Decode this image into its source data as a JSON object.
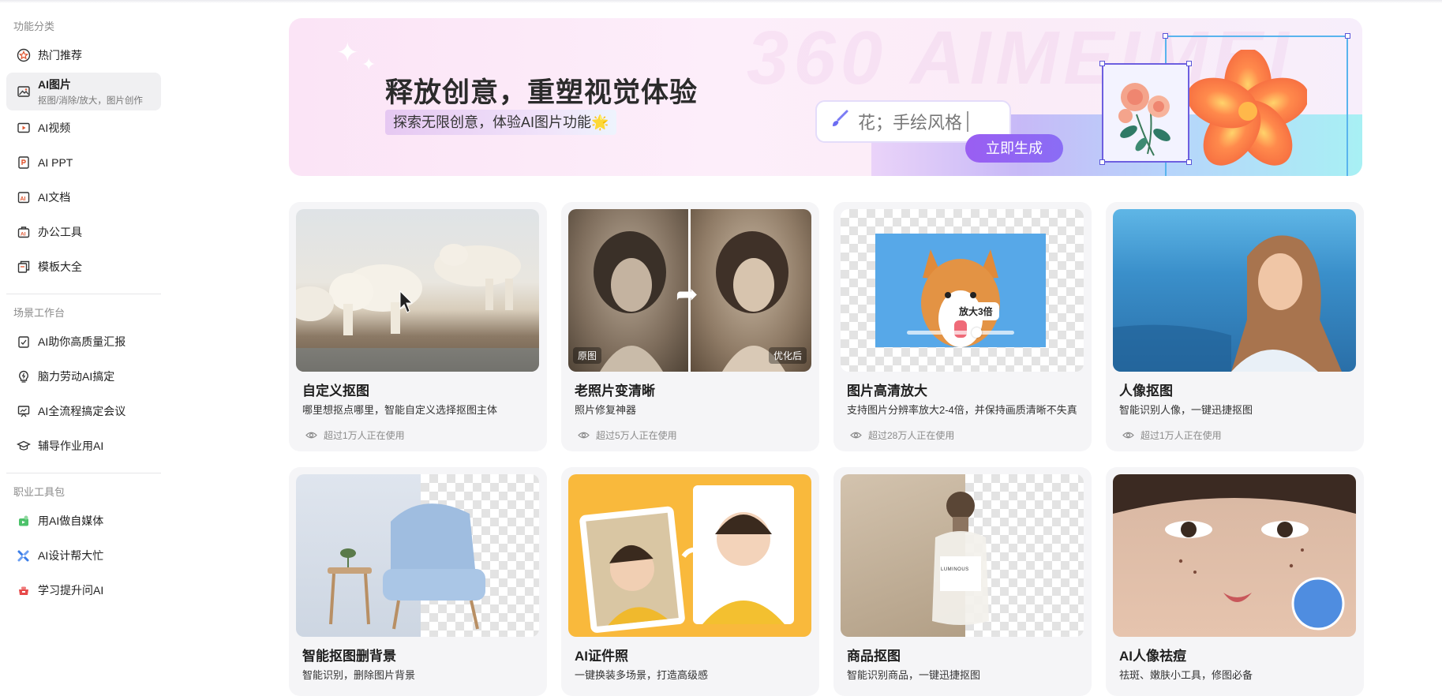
{
  "sidebar": {
    "groups": [
      {
        "title": "功能分类",
        "items": [
          {
            "label": "热门推荐",
            "icon": "hot-icon"
          },
          {
            "label": "AI图片",
            "sub": "抠图/消除/放大，图片创作",
            "icon": "image-icon",
            "active": true
          },
          {
            "label": "AI视频",
            "icon": "video-icon"
          },
          {
            "label": "AI PPT",
            "icon": "ppt-icon"
          },
          {
            "label": "AI文档",
            "icon": "doc-icon"
          },
          {
            "label": "办公工具",
            "icon": "office-icon"
          },
          {
            "label": "模板大全",
            "icon": "template-icon"
          }
        ]
      },
      {
        "title": "场景工作台",
        "items": [
          {
            "label": "AI助你高质量汇报",
            "icon": "report-icon"
          },
          {
            "label": "脑力劳动AI搞定",
            "icon": "brain-icon"
          },
          {
            "label": "AI全流程搞定会议",
            "icon": "meeting-icon"
          },
          {
            "label": "辅导作业用AI",
            "icon": "education-icon"
          }
        ]
      },
      {
        "title": "职业工具包",
        "items": [
          {
            "label": "用AI做自媒体",
            "icon": "media-icon"
          },
          {
            "label": "AI设计帮大忙",
            "icon": "design-icon"
          },
          {
            "label": "学习提升问AI",
            "icon": "study-icon"
          }
        ]
      }
    ]
  },
  "banner": {
    "headline": "释放创意，重塑视觉体验",
    "subline": "探索无限创意，体验AI图片功能🌟",
    "prompt_text": "花；手绘风格",
    "button_label": "立即生成",
    "ghost_text": "360 AIMEIMEI"
  },
  "cards": [
    {
      "title": "自定义抠图",
      "desc": "哪里想抠点哪里，智能自定义选择抠图主体",
      "usage": "超过1万人正在使用",
      "thumb": "polar-bears"
    },
    {
      "title": "老照片变清晰",
      "desc": "照片修复神器",
      "usage": "超过5万人正在使用",
      "thumb": "old-photo",
      "tag_before": "原图",
      "tag_after": "优化后"
    },
    {
      "title": "图片高清放大",
      "desc": "支持图片分辨率放大2-4倍，并保持画质清晰不失真",
      "usage": "超过28万人正在使用",
      "thumb": "corgi",
      "zoom_label": "放大3倍"
    },
    {
      "title": "人像抠图",
      "desc": "智能识别人像，一键迅捷抠图",
      "usage": "超过1万人正在使用",
      "thumb": "portrait-sea"
    },
    {
      "title": "智能抠图删背景",
      "desc": "智能识别，删除图片背景",
      "thumb": "chair"
    },
    {
      "title": "AI证件照",
      "desc": "一键换装多场景，打造高级感",
      "thumb": "id-photo"
    },
    {
      "title": "商品抠图",
      "desc": "智能识别商品，一键迅捷抠图",
      "thumb": "bottle",
      "bottle_label": "LUMINOUS"
    },
    {
      "title": "AI人像祛痘",
      "desc": "祛斑、嫩肤小工具，修图必备",
      "thumb": "face"
    }
  ],
  "colors": {
    "accent": "#8a6df5",
    "active_bg": "#f0f0f2",
    "card_bg": "#f5f5f7"
  }
}
